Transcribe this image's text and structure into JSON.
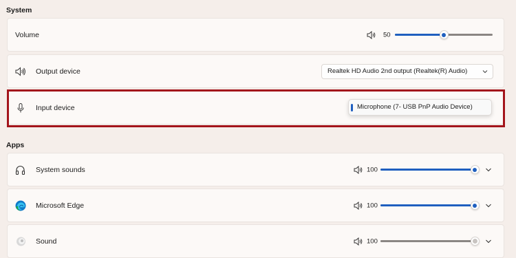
{
  "system_section": {
    "title": "System"
  },
  "volume": {
    "label": "Volume",
    "value": "50",
    "level": 0.5
  },
  "output_device": {
    "label": "Output device",
    "selected": "Realtek HD Audio 2nd output (Realtek(R) Audio)"
  },
  "input_device": {
    "label": "Input device",
    "selected": "Microphone (7- USB PnP Audio Device)"
  },
  "apps_section": {
    "title": "Apps"
  },
  "apps": [
    {
      "label": "System sounds",
      "value": "100",
      "level": 1.0,
      "icon": "headphones-icon",
      "enabled": true
    },
    {
      "label": "Microsoft Edge",
      "value": "100",
      "level": 1.0,
      "icon": "edge-logo-icon",
      "enabled": true
    },
    {
      "label": "Sound",
      "value": "100",
      "level": 1.0,
      "icon": "sound-app-icon",
      "enabled": false
    }
  ],
  "colors": {
    "accent": "#1f5fbf",
    "highlight": "#a3141b",
    "background": "#f5eeea"
  }
}
